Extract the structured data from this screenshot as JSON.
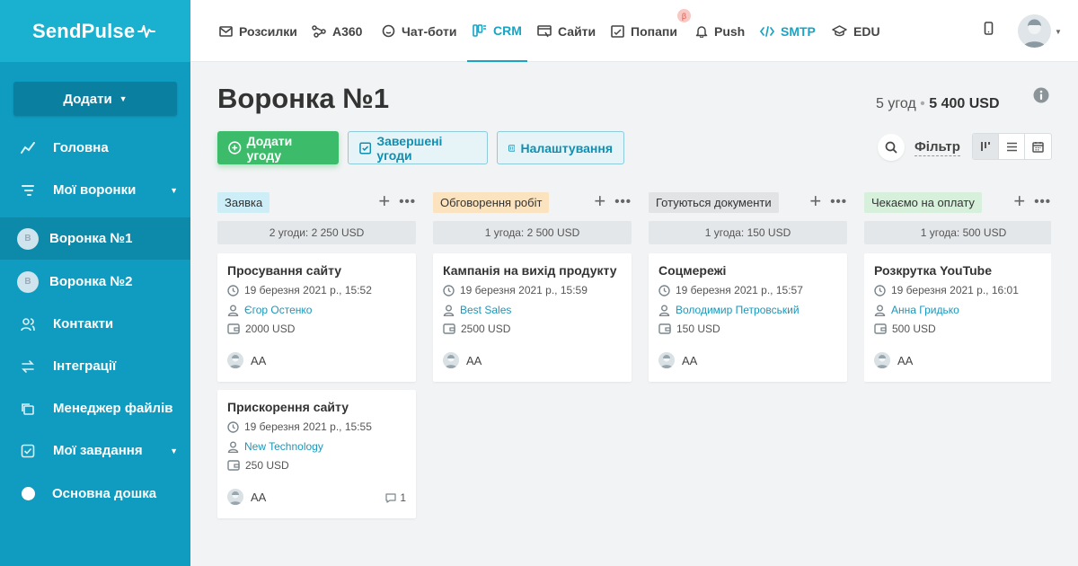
{
  "app": {
    "brand": "SendPulse"
  },
  "sidebar": {
    "add_label": "Додати",
    "items": [
      {
        "label": "Головна"
      },
      {
        "label": "Мої воронки"
      },
      {
        "label": "Воронка №1",
        "badge": "В"
      },
      {
        "label": "Воронка №2",
        "badge": "В"
      },
      {
        "label": "Контакти"
      },
      {
        "label": "Інтеграції"
      },
      {
        "label": "Менеджер файлів"
      },
      {
        "label": "Мої завдання"
      },
      {
        "label": "Основна дошка"
      }
    ]
  },
  "topnav": {
    "items": [
      {
        "label": "Розсилки",
        "icon": "mail-icon"
      },
      {
        "label": "A360",
        "icon": "a360-icon"
      },
      {
        "label": "Чат-боти",
        "icon": "chatbot-icon"
      },
      {
        "label": "CRM",
        "icon": "crm-icon"
      },
      {
        "label": "Сайти",
        "icon": "sites-icon"
      },
      {
        "label": "Попапи",
        "icon": "popups-icon"
      },
      {
        "label": "Push",
        "icon": "bell-icon"
      },
      {
        "label": "SMTP",
        "icon": "code-icon"
      },
      {
        "label": "EDU",
        "icon": "graduation-cap-icon"
      }
    ],
    "beta_badge": "β"
  },
  "page": {
    "title": "Воронка №1",
    "summary_count": "5 угод",
    "summary_separator": "•",
    "summary_total": "5 400 USD"
  },
  "toolbar": {
    "add_deal": "Додати угоду",
    "completed_deals": "Завершені угоди",
    "settings": "Налаштування",
    "filter": "Фільтр"
  },
  "columns": [
    {
      "label": "Заявка",
      "color": "#cdeef7",
      "summary": "2 угоди: 2 250 USD",
      "cards": [
        {
          "title": "Просування сайту",
          "date": "19 березня 2021 р., 15:52",
          "contact": "Єгор Остенко",
          "amount": "2000 USD",
          "user": "AA"
        },
        {
          "title": "Прискорення сайту",
          "date": "19 березня 2021 р., 15:55",
          "contact": "New Technology",
          "amount": "250 USD",
          "user": "AA",
          "comments": "1"
        }
      ]
    },
    {
      "label": "Обговорення робіт",
      "color": "#fbe3bf",
      "summary": "1 угода: 2 500 USD",
      "cards": [
        {
          "title": "Кампанія на вихід продукту",
          "date": "19 березня 2021 р., 15:59",
          "contact": "Best Sales",
          "amount": "2500 USD",
          "user": "AA"
        }
      ]
    },
    {
      "label": "Готуються документи",
      "color": "#e1e3e5",
      "summary": "1 угода: 150 USD",
      "cards": [
        {
          "title": "Соцмережі",
          "date": "19 березня 2021 р., 15:57",
          "contact": "Володимир Петровський",
          "amount": "150 USD",
          "user": "AA"
        }
      ]
    },
    {
      "label": "Чекаємо на оплату",
      "color": "#d6f0dc",
      "summary": "1 угода: 500 USD",
      "cards": [
        {
          "title": "Розкрутка YouTube",
          "date": "19 березня 2021 р., 16:01",
          "contact": "Анна Гридько",
          "amount": "500 USD",
          "user": "AA"
        }
      ]
    }
  ]
}
